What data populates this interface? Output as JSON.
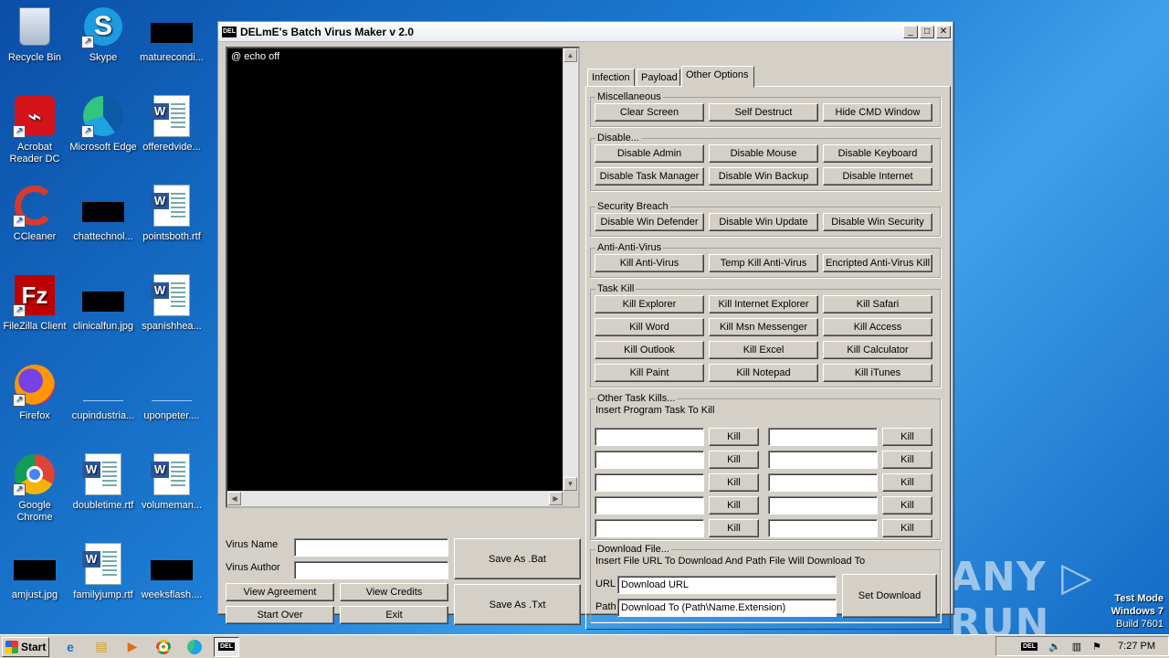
{
  "desktop": {
    "icons": [
      {
        "label": "Recycle Bin"
      },
      {
        "label": "Skype"
      },
      {
        "label": "maturecondi..."
      },
      {
        "label": "Acrobat Reader DC"
      },
      {
        "label": "Microsoft Edge"
      },
      {
        "label": "offeredvide..."
      },
      {
        "label": "CCleaner"
      },
      {
        "label": "chattechnol..."
      },
      {
        "label": "pointsboth.rtf"
      },
      {
        "label": "FileZilla Client"
      },
      {
        "label": "clinicalfun.jpg"
      },
      {
        "label": "spanishhea..."
      },
      {
        "label": "Firefox"
      },
      {
        "label": "cupindustria..."
      },
      {
        "label": "uponpeter...."
      },
      {
        "label": "Google Chrome"
      },
      {
        "label": "doubletime.rtf"
      },
      {
        "label": "volumeman..."
      },
      {
        "label": "amjust.jpg"
      },
      {
        "label": "familyjump.rtf"
      },
      {
        "label": "weeksflash...."
      }
    ]
  },
  "window": {
    "icon_text": "DEL",
    "title": "DELmE's Batch Virus Maker v 2.0",
    "min": "_",
    "max": "□",
    "close": "✕"
  },
  "editor": {
    "content": "@ echo off"
  },
  "form": {
    "virus_name_label": "Virus Name",
    "virus_name_value": "",
    "virus_author_label": "Virus Author",
    "virus_author_value": "",
    "view_agreement": "View Agreement",
    "view_credits": "View Credits",
    "start_over": "Start Over",
    "exit": "Exit",
    "save_bat": "Save As .Bat",
    "save_txt": "Save As .Txt"
  },
  "tabs": [
    "Infection",
    "Payload",
    "Other Options"
  ],
  "groups": {
    "misc": {
      "title": "Miscellaneous",
      "buttons": [
        "Clear Screen",
        "Self Destruct",
        "Hide CMD Window"
      ]
    },
    "disable": {
      "title": "Disable...",
      "buttons": [
        "Disable Admin",
        "Disable Mouse",
        "Disable Keyboard",
        "Disable Task Manager",
        "Disable Win Backup",
        "Disable Internet"
      ]
    },
    "security": {
      "title": "Security Breach",
      "buttons": [
        "Disable Win Defender",
        "Disable Win Update",
        "Disable Win Security"
      ]
    },
    "antiav": {
      "title": "Anti-Anti-Virus",
      "buttons": [
        "Kill Anti-Virus",
        "Temp Kill Anti-Virus",
        "Encripted Anti-Virus Kill"
      ]
    },
    "taskkill": {
      "title": "Task Kill",
      "buttons": [
        "Kill Explorer",
        "Kill Internet Explorer",
        "Kill Safari",
        "Kill Word",
        "Kill Msn Messenger",
        "Kill Access",
        "Kill Outlook",
        "Kill Excel",
        "Kill Calculator",
        "Kill Paint",
        "Kill Notepad",
        "Kill iTunes"
      ]
    },
    "othertask": {
      "title": "Other Task Kills...",
      "subtitle": "Insert Program Task To Kill",
      "kill_label": "Kill"
    },
    "download": {
      "title": "Download File...",
      "subtitle": "Insert File URL To Download And Path File Will Download To",
      "url_label": "URL",
      "url_value": "Download URL",
      "path_label": "Path",
      "path_value": "Download To (Path\\Name.Extension)",
      "set_button": "Set Download"
    }
  },
  "watermark": "ANY ▷ RUN",
  "testmode": {
    "line1": "Test Mode",
    "line2": "Windows 7",
    "line3": "Build 7601"
  },
  "taskbar": {
    "start": "Start",
    "task_label": "DEL",
    "tray_app": "DEL",
    "clock": "7:27 PM"
  }
}
